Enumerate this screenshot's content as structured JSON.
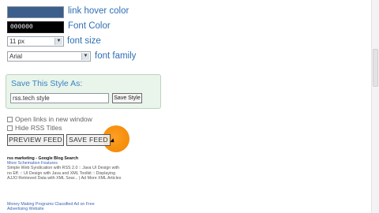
{
  "colors": {
    "link_hover_swatch": "#3b5e8c",
    "font_color_swatch": "#000000",
    "label_blue": "#2f6fb4",
    "accent_orange": "#f58a00"
  },
  "settings": {
    "link_hover_label": "link hover color",
    "font_color_value": "000000",
    "font_color_label": "Font Color",
    "font_size_value": "11 px",
    "font_size_label": "font size",
    "font_family_value": "Arial",
    "font_family_label": "font family"
  },
  "save_style": {
    "title": "Save This Style As:",
    "input_value": "rss.tech style",
    "button_label": "Save Style"
  },
  "options": {
    "open_links_label": "Open links in new window",
    "hide_titles_label": "Hide RSS Titles"
  },
  "buttons": {
    "preview_label": "PREVIEW FEED",
    "save_label": "SAVE FEED"
  },
  "feed": {
    "heading": "rss marketing - Google Blog Search",
    "link1": "More Schemation Features",
    "body1": "Simple Web Syndication with RSS 2.0 :: Java UI Design with",
    "body2": "no Eff. :: UI Design with Java and XML Toolkit :: Displaying",
    "body3": "AJJO Retrieved Data with XML Sear... | Ad More XML Articles",
    "link2": "Money Making Programs Classified Ad on Free",
    "link3": "Advertising Website"
  }
}
